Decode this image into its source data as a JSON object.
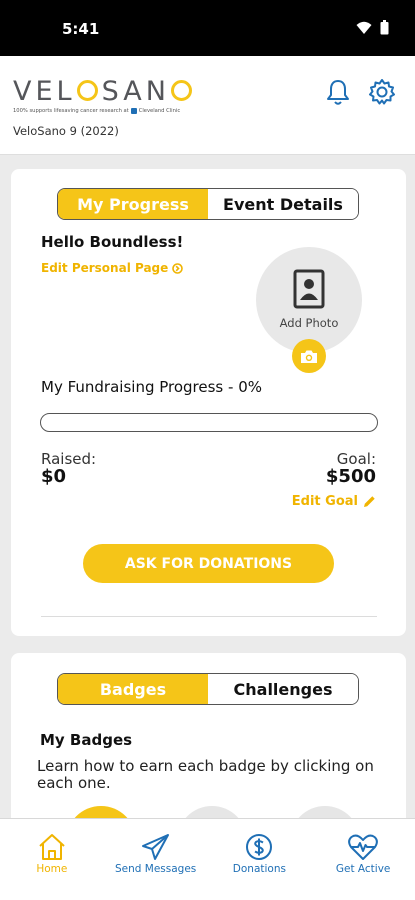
{
  "status_bar": {
    "time": "5:41"
  },
  "header": {
    "logo_left": "VEL",
    "logo_right": "SAN",
    "logo_end": "",
    "tagline": "100% supports lifesaving cancer research at",
    "tagline_org": "Cleveland Clinic",
    "event_name": "VeloSano 9 (2022)",
    "icons": [
      "bell-icon",
      "gear-icon"
    ]
  },
  "progress_card": {
    "tabs": [
      {
        "label": "My Progress",
        "active": true
      },
      {
        "label": "Event Details",
        "active": false
      }
    ],
    "greeting": "Hello Boundless!",
    "edit_personal_page": "Edit Personal Page",
    "add_photo": "Add Photo",
    "fundraising_title": "My Fundraising Progress - 0%",
    "progress_fraction": 0,
    "raised_label": "Raised:",
    "raised_value": "$0",
    "goal_label": "Goal:",
    "goal_value": "$500",
    "edit_goal": "Edit Goal",
    "ask_button": "ASK FOR DONATIONS"
  },
  "badges_card": {
    "tabs": [
      {
        "label": "Badges",
        "active": true
      },
      {
        "label": "Challenges",
        "active": false
      }
    ],
    "title": "My Badges",
    "description": "Learn how to earn each badge by clicking on each one."
  },
  "bottom_nav": [
    {
      "label": "Home",
      "icon": "home-icon",
      "active": true
    },
    {
      "label": "Send Messages",
      "icon": "paper-plane-icon",
      "active": false
    },
    {
      "label": "Donations",
      "icon": "dollar-circle-icon",
      "active": false
    },
    {
      "label": "Get Active",
      "icon": "heart-pulse-icon",
      "active": false
    }
  ],
  "colors": {
    "accent": "#f5c518",
    "link_blue": "#1f6fb5",
    "background": "#ebebeb"
  }
}
